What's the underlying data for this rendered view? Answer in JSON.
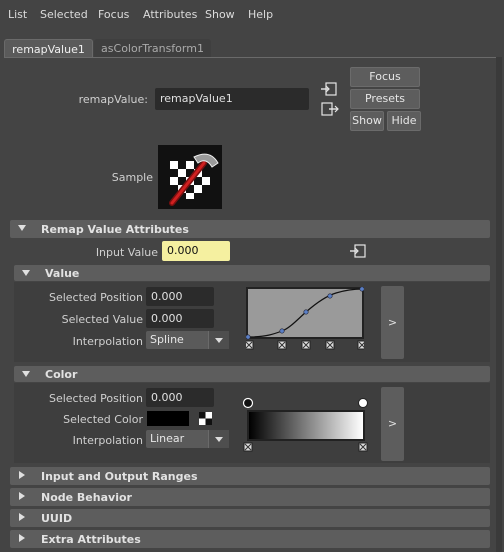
{
  "menu": [
    "List",
    "Selected",
    "Focus",
    "Attributes",
    "Show",
    "Help"
  ],
  "tabs": [
    {
      "label": "remapValue1",
      "active": true
    },
    {
      "label": "asColorTransform1",
      "active": false
    }
  ],
  "node": {
    "name_label": "remapValue:",
    "name_value": "remapValue1",
    "sample_label": "Sample"
  },
  "buttons": {
    "focus": "Focus",
    "presets": "Presets",
    "show": "Show",
    "hide": "Hide"
  },
  "sections": {
    "remap": "Remap Value Attributes",
    "value": "Value",
    "color": "Color",
    "ranges": "Input and Output Ranges",
    "behavior": "Node Behavior",
    "uuid": "UUID",
    "extra": "Extra Attributes"
  },
  "input_value": {
    "label": "Input Value",
    "value": "0.000"
  },
  "value_section": {
    "selected_position_label": "Selected Position",
    "selected_position": "0.000",
    "selected_value_label": "Selected Value",
    "selected_value": "0.000",
    "interpolation_label": "Interpolation",
    "interpolation": "Spline",
    "expand_label": ">"
  },
  "color_section": {
    "selected_position_label": "Selected Position",
    "selected_position": "0.000",
    "selected_color_label": "Selected Color",
    "selected_color": "#000000",
    "interpolation_label": "Interpolation",
    "interpolation": "Linear",
    "expand_label": ">"
  },
  "colors": {
    "background": "#444444",
    "panel": "#3e3e3e",
    "header": "#5d5d5d",
    "input_highlight": "#f5f0a0",
    "curve_bg": "#999999",
    "curve_line": "#1a1a1a",
    "curve_point": "#4a6fb5"
  }
}
